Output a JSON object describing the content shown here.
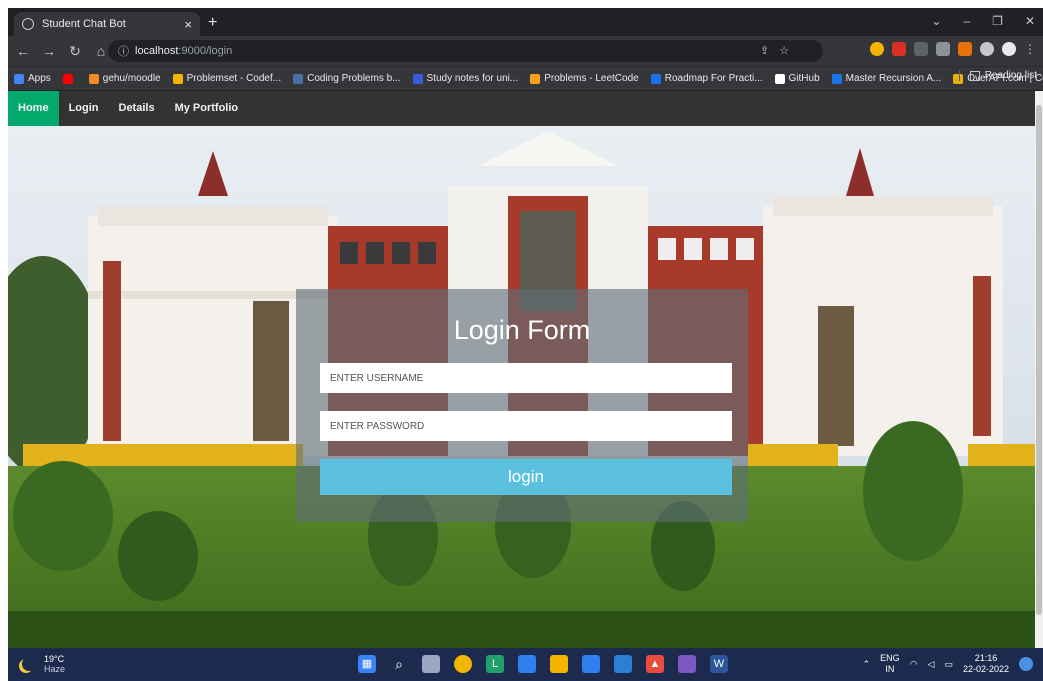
{
  "browser": {
    "tab_title": "Student Chat Bot",
    "tab_close": "×",
    "new_tab": "+",
    "url_host": "localhost",
    "url_path": ":9000/login",
    "window_controls": [
      "⌄",
      "–",
      "❐",
      "✕"
    ],
    "bookmarks": [
      {
        "label": "Apps",
        "color": "#4285f4"
      },
      {
        "label": "",
        "color": "#ff0000"
      },
      {
        "label": "gehu/moodle",
        "color": "#f28c28"
      },
      {
        "label": "Problemset - Codef...",
        "color": "#f5b400"
      },
      {
        "label": "Coding Problems b...",
        "color": "#4a6fa5"
      },
      {
        "label": "Study notes for uni...",
        "color": "#3b5bdb"
      },
      {
        "label": "Problems - LeetCode",
        "color": "#ffa116"
      },
      {
        "label": "Roadmap For Practi...",
        "color": "#1a73e8"
      },
      {
        "label": "GitHub",
        "color": "#ffffff"
      },
      {
        "label": "Master Recursion A...",
        "color": "#1a73e8"
      },
      {
        "label": "OverAPI.com | Colle...",
        "color": "#e8b00f"
      }
    ],
    "reading_list": "Reading list"
  },
  "nav": {
    "items": [
      "Home",
      "Login",
      "Details",
      "My Portfolio"
    ],
    "active": "Home"
  },
  "login": {
    "title": "Login Form",
    "username_placeholder": "ENTER USERNAME",
    "password_placeholder": "ENTER PASSWORD",
    "button": "login"
  },
  "taskbar": {
    "temp": "19°C",
    "condition": "Haze",
    "lang_top": "ENG",
    "lang_bottom": "IN",
    "time": "21:16",
    "date": "22-02-2022"
  },
  "colors": {
    "nav_active": "#04aa6d",
    "login_button": "#5bc0de"
  }
}
